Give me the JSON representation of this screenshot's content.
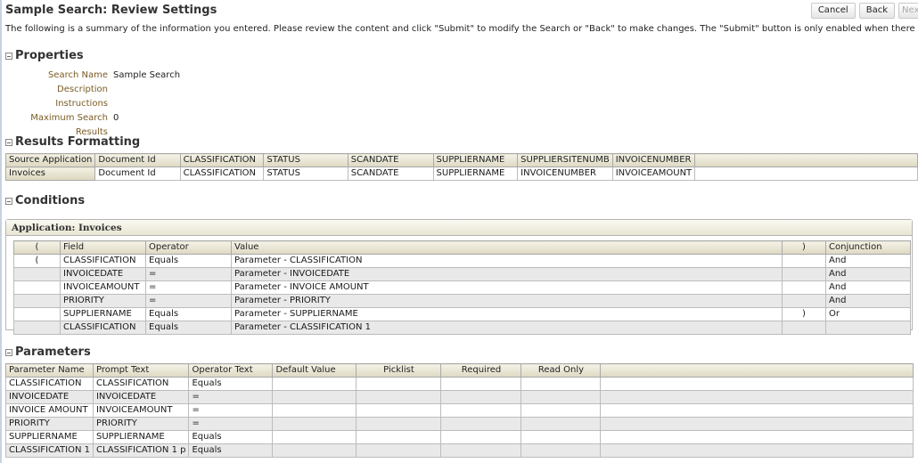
{
  "page": {
    "title": "Sample Search: Review Settings",
    "instructions": "The following is a summary of the information you entered. Please review the content and click \"Submit\" to modify the Search or \"Back\" to make changes. The \"Submit\" button is only enabled when there are changes."
  },
  "toolbar": {
    "cancel_label": "Cancel",
    "back_label": "Back",
    "next_label": "Next"
  },
  "properties": {
    "heading": "Properties",
    "rows": [
      {
        "label": "Search Name",
        "value": "Sample Search"
      },
      {
        "label": "Description",
        "value": ""
      },
      {
        "label": "Instructions",
        "value": ""
      },
      {
        "label": "Maximum Search Results",
        "value": "0"
      }
    ]
  },
  "results_formatting": {
    "heading": "Results Formatting",
    "header_row": [
      "Source Application",
      "Document Id",
      "CLASSIFICATION",
      "STATUS",
      "SCANDATE",
      "SUPPLIERNAME",
      "SUPPLIERSITENUMB",
      "INVOICENUMBER",
      ""
    ],
    "rows": [
      [
        "Invoices",
        "Document Id",
        "CLASSIFICATION",
        "STATUS",
        "SCANDATE",
        "SUPPLIERNAME",
        "INVOICENUMBER",
        "INVOICEAMOUNT",
        ""
      ]
    ]
  },
  "conditions": {
    "heading": "Conditions",
    "application_label": "Application: Invoices",
    "columns": [
      "(",
      "Field",
      "Operator",
      "Value",
      ")",
      "Conjunction"
    ],
    "rows": [
      [
        "(",
        "CLASSIFICATION",
        "Equals",
        "Parameter - CLASSIFICATION",
        "",
        "And"
      ],
      [
        "",
        "INVOICEDATE",
        "=",
        "Parameter - INVOICEDATE",
        "",
        "And"
      ],
      [
        "",
        "INVOICEAMOUNT",
        "=",
        "Parameter - INVOICE AMOUNT",
        "",
        "And"
      ],
      [
        "",
        "PRIORITY",
        "=",
        "Parameter - PRIORITY",
        "",
        "And"
      ],
      [
        "",
        "SUPPLIERNAME",
        "Equals",
        "Parameter - SUPPLIERNAME",
        ")",
        "Or"
      ],
      [
        "",
        "CLASSIFICATION",
        "Equals",
        "Parameter - CLASSIFICATION 1",
        "",
        ""
      ]
    ]
  },
  "parameters": {
    "heading": "Parameters",
    "columns": [
      "Parameter Name",
      "Prompt Text",
      "Operator Text",
      "Default Value",
      "Picklist",
      "Required",
      "Read Only",
      ""
    ],
    "rows": [
      [
        "CLASSIFICATION",
        "CLASSIFICATION",
        "Equals",
        "",
        "",
        "",
        "",
        ""
      ],
      [
        "INVOICEDATE",
        "INVOICEDATE",
        "=",
        "",
        "",
        "",
        "",
        ""
      ],
      [
        "INVOICE AMOUNT",
        "INVOICEAMOUNT",
        "=",
        "",
        "",
        "",
        "",
        ""
      ],
      [
        "PRIORITY",
        "PRIORITY",
        "=",
        "",
        "",
        "",
        "",
        ""
      ],
      [
        "SUPPLIERNAME",
        "SUPPLIERNAME",
        "Equals",
        "",
        "",
        "",
        "",
        ""
      ],
      [
        "CLASSIFICATION 1",
        "CLASSIFICATION 1 p",
        "Equals",
        "",
        "",
        "",
        "",
        ""
      ]
    ]
  }
}
